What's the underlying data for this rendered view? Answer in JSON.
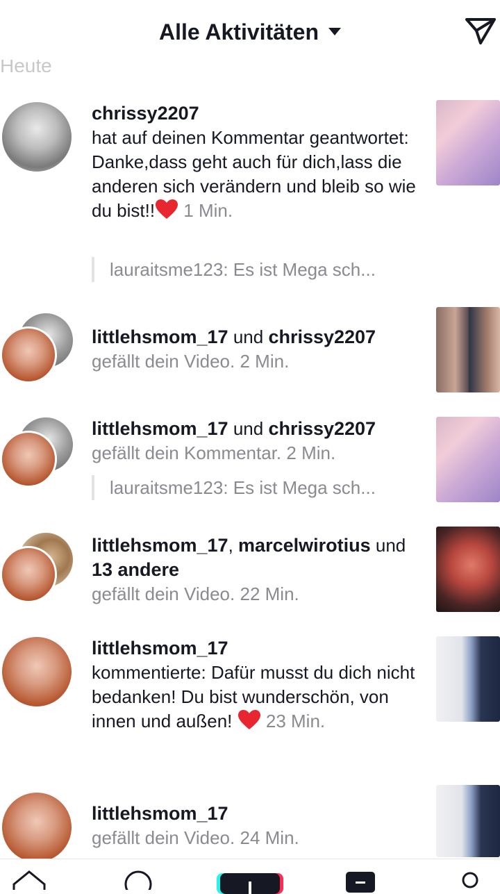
{
  "header": {
    "title": "Alle Aktivitäten"
  },
  "section": {
    "label": "Heute"
  },
  "items": [
    {
      "user": "chrissy2207",
      "text": "hat auf deinen Kommentar geantwortet: Danke,dass geht auch für dich,lass die anderen sich verändern und bleib so wie du bist!!",
      "time": "1 Min.",
      "quote": "lauraitsme123: Es ist Mega sch..."
    },
    {
      "user1": "littlehsmom_17",
      "conj": "und",
      "user2": "chrissy2207",
      "action": "gefällt dein Video.",
      "time": "2 Min."
    },
    {
      "user1": "littlehsmom_17",
      "conj": "und",
      "user2": "chrissy2207",
      "action": "gefällt dein Kommentar.",
      "time": "2 Min.",
      "quote": "lauraitsme123: Es ist Mega sch..."
    },
    {
      "user1": "littlehsmom_17",
      "sep": ",",
      "user2": "marcelwirotius",
      "conj": "und",
      "others": "13 andere",
      "action": "gefällt dein Video.",
      "time": "22 Min."
    },
    {
      "user": "littlehsmom_17",
      "text": "kommentierte: Dafür musst du dich nicht bedanken! Du bist wunderschön, von innen und außen!",
      "time": "23 Min."
    },
    {
      "user": "littlehsmom_17",
      "action": "gefällt dein Video.",
      "time": "24 Min."
    }
  ],
  "nav": {
    "icons": [
      "home-icon",
      "discover-icon",
      "create-icon",
      "inbox-icon",
      "profile-icon"
    ]
  },
  "colors": {
    "heart": "#e8262f",
    "accent_cyan": "#25f4ee",
    "accent_red": "#fe2c55"
  }
}
